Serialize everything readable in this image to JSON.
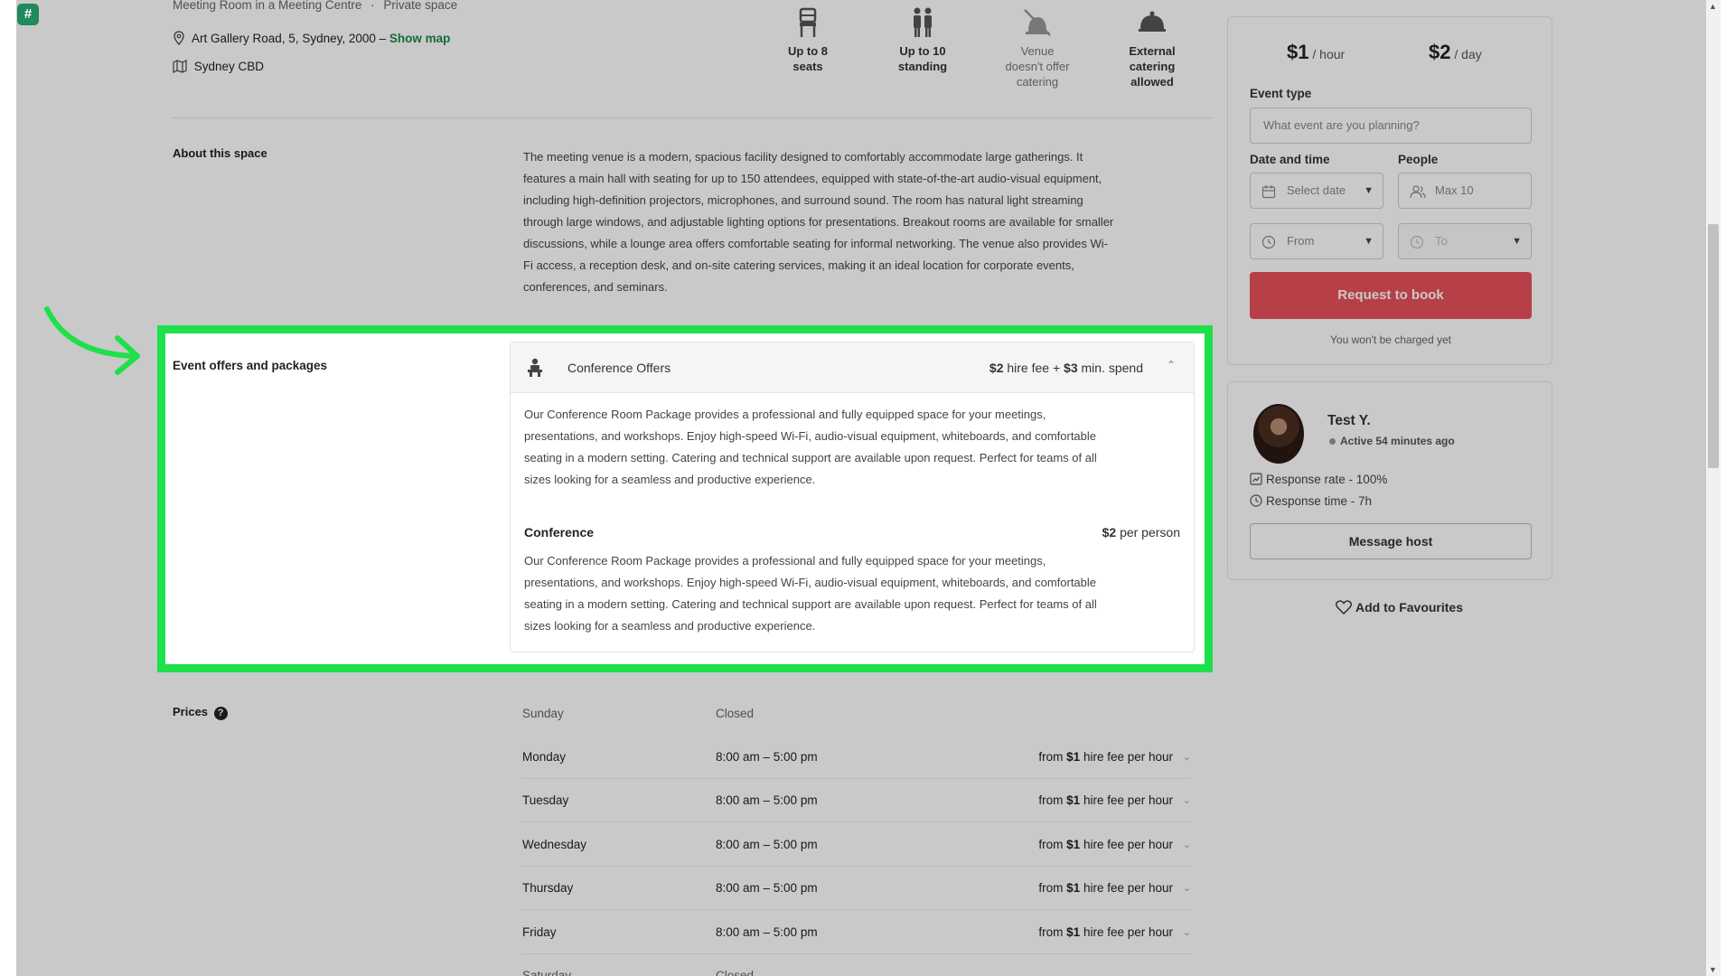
{
  "header": {
    "subtitle": "Meeting Room in a Meeting Centre",
    "space_type": "Private space",
    "separator": "·",
    "address": "Art Gallery Road, 5, Sydney, 2000",
    "address_dash": "–",
    "show_map": "Show map",
    "area": "Sydney CBD"
  },
  "features": [
    {
      "icon": "chair-icon",
      "line1": "Up to 8",
      "line2": "seats",
      "line3": "",
      "muted": false
    },
    {
      "icon": "standing-people-icon",
      "line1": "Up to 10",
      "line2": "standing",
      "line3": "",
      "muted": false
    },
    {
      "icon": "no-catering-icon",
      "line1": "Venue",
      "line2": "doesn't offer",
      "line3": "catering",
      "muted": true
    },
    {
      "icon": "cloche-icon",
      "line1": "External",
      "line2": "catering",
      "line3": "allowed",
      "muted": false
    }
  ],
  "about": {
    "title": "About this space",
    "lines": [
      "The meeting venue is a modern, spacious facility designed to comfortably accommodate large gatherings. It",
      "features a main hall with seating for up to 150 attendees, equipped with state-of-the-art audio-visual equipment,",
      "including high-definition projectors, microphones, and surround sound. The room has natural light streaming",
      "through large windows, and adjustable lighting options for presentations. Breakout rooms are available for smaller",
      "discussions, while a lounge area offers comfortable seating for informal networking. The venue also provides Wi-",
      "Fi access, a reception desk, and on-site catering services, making it an ideal location for corporate events,",
      "conferences, and seminars."
    ]
  },
  "offers": {
    "title": "Event offers and packages",
    "package_name": "Conference Offers",
    "hire_fee_amount": "$2",
    "hire_fee_label": "hire fee",
    "plus": "+",
    "min_spend_amount": "$3",
    "min_spend_label": "min. spend",
    "description_lines": [
      "Our Conference Room Package provides a professional and fully equipped space for your meetings,",
      "presentations, and workshops. Enjoy high-speed Wi-Fi, audio-visual equipment, whiteboards, and comfortable",
      "seating in a modern setting. Catering and technical support are available upon request. Perfect for teams of all",
      "sizes looking for a seamless and productive experience."
    ],
    "item_name": "Conference",
    "item_price": "$2",
    "item_unit": "per person",
    "item_description_lines": [
      "Our Conference Room Package provides a professional and fully equipped space for your meetings,",
      "presentations, and workshops. Enjoy high-speed Wi-Fi, audio-visual equipment, whiteboards, and comfortable",
      "seating in a modern setting. Catering and technical support are available upon request. Perfect for teams of all",
      "sizes looking for a seamless and productive experience."
    ]
  },
  "prices": {
    "title": "Prices",
    "help_glyph": "?",
    "rows": [
      {
        "day": "Sunday",
        "time": "Closed",
        "from": "",
        "amount": "",
        "suffix": "",
        "closed": true
      },
      {
        "day": "Monday",
        "time": "8:00 am – 5:00 pm",
        "from": "from",
        "amount": "$1",
        "suffix": "hire fee per hour",
        "closed": false
      },
      {
        "day": "Tuesday",
        "time": "8:00 am – 5:00 pm",
        "from": "from",
        "amount": "$1",
        "suffix": "hire fee per hour",
        "closed": false
      },
      {
        "day": "Wednesday",
        "time": "8:00 am – 5:00 pm",
        "from": "from",
        "amount": "$1",
        "suffix": "hire fee per hour",
        "closed": false
      },
      {
        "day": "Thursday",
        "time": "8:00 am – 5:00 pm",
        "from": "from",
        "amount": "$1",
        "suffix": "hire fee per hour",
        "closed": false
      },
      {
        "day": "Friday",
        "time": "8:00 am – 5:00 pm",
        "from": "from",
        "amount": "$1",
        "suffix": "hire fee per hour",
        "closed": false
      },
      {
        "day": "Saturday",
        "time": "Closed",
        "from": "",
        "amount": "",
        "suffix": "",
        "closed": true
      }
    ]
  },
  "booking": {
    "price_hour": "$1",
    "price_hour_unit": "/ hour",
    "price_day": "$2",
    "price_day_unit": "/ day",
    "event_type_label": "Event type",
    "event_type_placeholder": "What event are you planning?",
    "date_time_label": "Date and time",
    "people_label": "People",
    "select_date": "Select date",
    "max_people": "Max 10",
    "from": "From",
    "to": "To",
    "request_button": "Request to book",
    "note": "You won't be charged yet"
  },
  "host": {
    "name": "Test Y.",
    "status": "Active 54 minutes ago",
    "response_rate": "Response rate - 100%",
    "response_time": "Response time - 7h",
    "message_button": "Message host",
    "favourites": "Add to Favourites"
  },
  "app": {
    "logo_glyph": "#"
  },
  "colors": {
    "accent_green": "#1a8a4c",
    "highlight_green": "#1ee04a",
    "primary_red": "#e8505b"
  }
}
